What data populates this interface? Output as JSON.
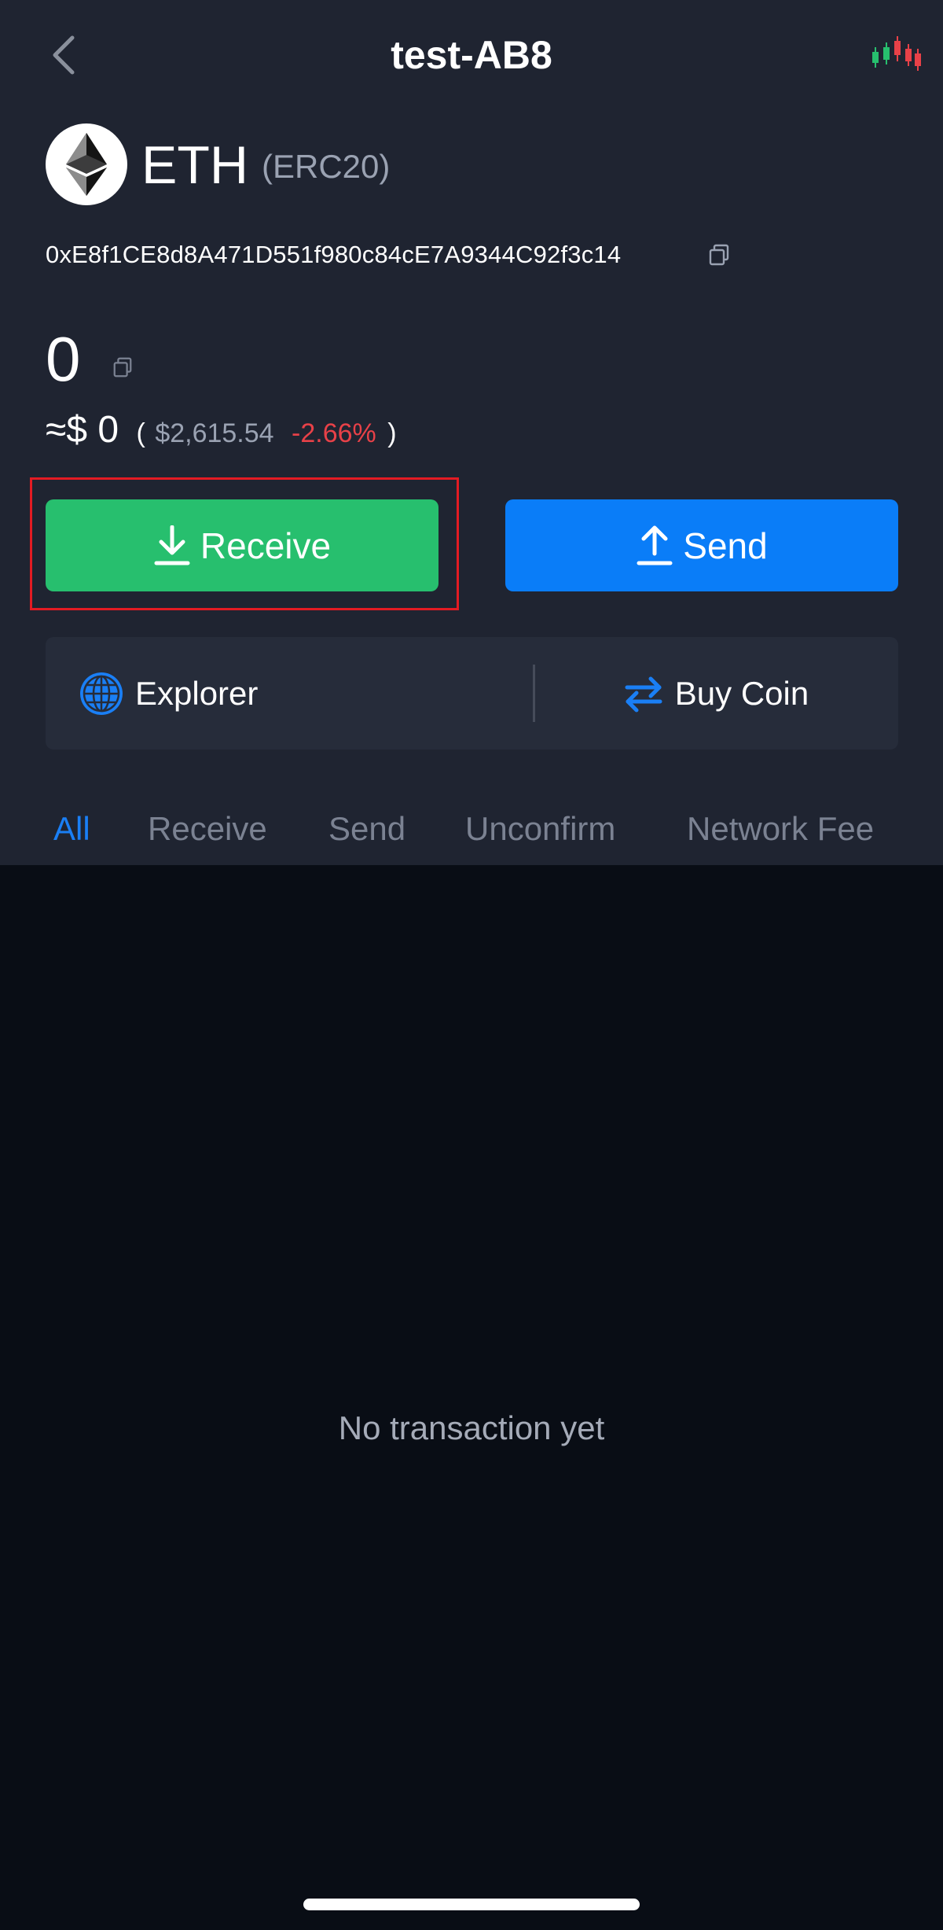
{
  "header": {
    "title": "test-AB8"
  },
  "coin": {
    "symbol": "ETH",
    "network": "(ERC20)",
    "address": "0xE8f1CE8d8A471D551f980c84cE7A9344C92f3c14"
  },
  "balance": {
    "amount": "0",
    "fiat_prefix": "≈$ 0",
    "paren_open": "(",
    "price": "$2,615.54",
    "change": "-2.66%",
    "paren_close": ")"
  },
  "actions": {
    "receive_label": "Receive",
    "send_label": "Send",
    "explorer_label": "Explorer",
    "buy_coin_label": "Buy Coin"
  },
  "tabs": [
    {
      "label": "All",
      "active": true
    },
    {
      "label": "Receive",
      "active": false
    },
    {
      "label": "Send",
      "active": false
    },
    {
      "label": "Unconfirm",
      "active": false
    },
    {
      "label": "Network Fee",
      "active": false
    }
  ],
  "empty_state": {
    "message": "No transaction yet"
  },
  "colors": {
    "background_top": "#1f2431",
    "background_bottom": "#090d15",
    "receive_green": "#27bf6e",
    "send_blue": "#0a7df8",
    "active_tab": "#1a7ff5",
    "negative_change": "#e84148",
    "highlight_red": "#e31b23"
  },
  "icons": {
    "back": "chevron-left-icon",
    "chart": "candlestick-chart-icon",
    "coin": "ethereum-logo-icon",
    "copy": "copy-icon",
    "receive": "download-arrow-icon",
    "send": "upload-arrow-icon",
    "explorer": "globe-icon",
    "buy_coin": "swap-arrows-icon"
  }
}
